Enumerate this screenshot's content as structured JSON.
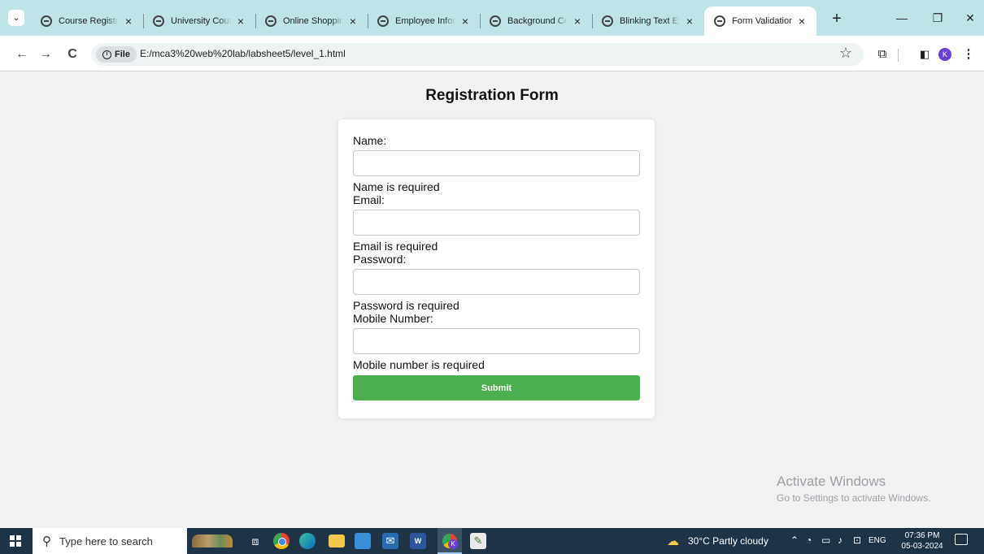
{
  "browser": {
    "tabs": [
      {
        "title": "Course Registration",
        "active": false
      },
      {
        "title": "University Course",
        "active": false
      },
      {
        "title": "Online Shopping",
        "active": false
      },
      {
        "title": "Employee Information",
        "active": false
      },
      {
        "title": "Background Color",
        "active": false
      },
      {
        "title": "Blinking Text Example",
        "active": false
      },
      {
        "title": "Form Validation",
        "active": true
      }
    ],
    "tab_close": "×",
    "new_tab": "+",
    "tab_menu": "⌄",
    "window": {
      "minimize": "—",
      "maximize": "❐",
      "close": "✕"
    },
    "nav": {
      "back": "←",
      "forward": "→",
      "reload": "C"
    },
    "omnibox": {
      "chip_label": "File",
      "url": "E:/mca3%20web%20lab/labsheet5/level_1.html"
    },
    "bookmark": "☆",
    "profile_initial": "K"
  },
  "page": {
    "title": "Registration Form",
    "fields": [
      {
        "label": "Name:",
        "value": "",
        "error": "Name is required"
      },
      {
        "label": "Email:",
        "value": "",
        "error": "Email is required"
      },
      {
        "label": "Password:",
        "value": "",
        "error": "Password is required"
      },
      {
        "label": "Mobile Number:",
        "value": "",
        "error": "Mobile number is required"
      }
    ],
    "submit_label": "Submit",
    "watermark": {
      "title": "Activate Windows",
      "subtitle": "Go to Settings to activate Windows."
    }
  },
  "taskbar": {
    "search_placeholder": "Type here to search",
    "weather": "30°C  Partly cloudy",
    "language": "ENG",
    "time": "07:36 PM",
    "date": "05-03-2024",
    "word_label": "W"
  },
  "colors": {
    "tabbar": "#bfe3e7",
    "submit_button": "#4caf50",
    "taskbar": "#1f3347",
    "profile": "#6a3fd6"
  }
}
